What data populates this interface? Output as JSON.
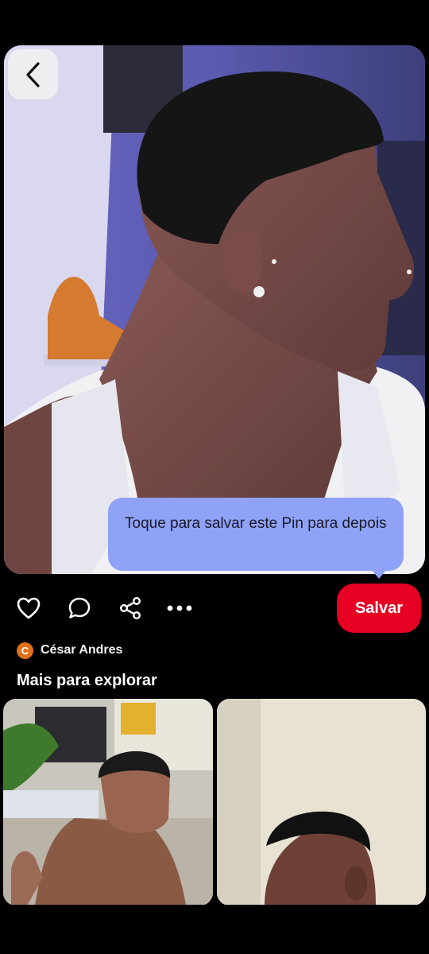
{
  "pin": {
    "image_alt": "Foto de perfil de jovem com corte degradê"
  },
  "tooltip": {
    "text": "Toque para salvar este Pin para depois"
  },
  "actions": {
    "like_icon": "heart-icon",
    "comment_icon": "comment-icon",
    "share_icon": "share-icon",
    "more_icon": "more-icon",
    "save_label": "Salvar"
  },
  "author": {
    "initial": "C",
    "name": "César Andres"
  },
  "explore": {
    "title": "Mais para explorar"
  },
  "colors": {
    "save_red": "#e60023",
    "tooltip_blue": "#8fa2f7",
    "avatar_orange": "#e0711c"
  }
}
